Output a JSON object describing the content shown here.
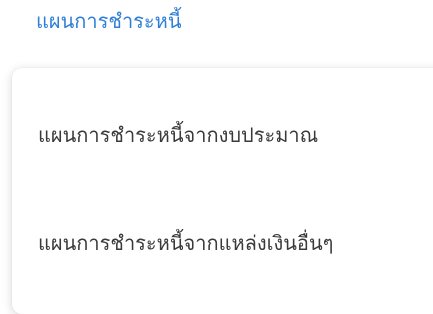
{
  "nav": {
    "label": "แผนการชำระหนี้",
    "accent_color": "#2f7fd6"
  },
  "dropdown": {
    "items": [
      {
        "label": "แผนการชำระหนี้จากงบประมาณ"
      },
      {
        "label": "แผนการชำระหนี้จากแหล่งเงินอื่นๆ"
      }
    ]
  }
}
